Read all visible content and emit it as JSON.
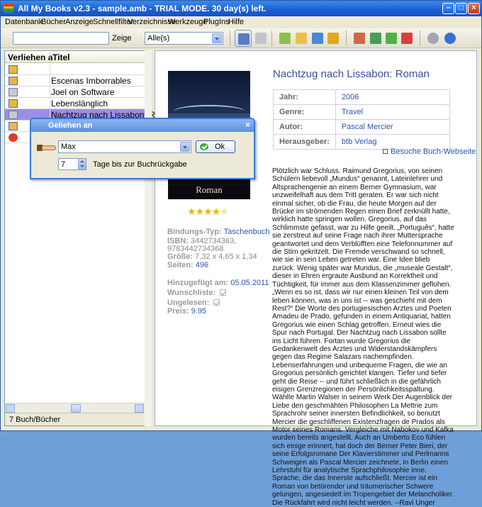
{
  "window": {
    "title": "All My Books v2.3 - sample.amb - TRIAL MODE. 30 day(s) left."
  },
  "menu": [
    "Datenbank",
    "Bücher",
    "Anzeige",
    "Schnellfilter",
    "Verzeichnisse",
    "Werkzeuge",
    "PlugIns",
    "Hilfe"
  ],
  "toolbar": {
    "search_value": "",
    "show_label": "Zeige",
    "filter_value": "Alle(s)",
    "buttons": [
      "view-details-icon",
      "view-books-icon",
      "add-book-icon",
      "open-folder-icon",
      "search-online-icon",
      "key-icon",
      "list-edit-icon",
      "list-add-icon",
      "list-green-icon",
      "list-delete-icon",
      "settings-icon",
      "help-icon"
    ]
  },
  "book_list": {
    "columns": {
      "lent": "Verliehen a",
      "title": "Titel"
    },
    "rows": [
      {
        "status": "book",
        "title": ""
      },
      {
        "status": "book",
        "title": "Escenas Imborrables"
      },
      {
        "status": "cart",
        "title": "Joel on Software"
      },
      {
        "status": "book",
        "title": "Lebenslänglich"
      },
      {
        "status": "cart",
        "title": "Nachtzug nach Lissabon: Ro"
      },
      {
        "status": "book",
        "title": ""
      },
      {
        "status": "warning",
        "title": ""
      }
    ],
    "status_text": "7 Buch/Bücher"
  },
  "book": {
    "title": "Nachtzug nach Lissabon: Roman",
    "cover_text": "Roman",
    "rating": 4,
    "info": [
      {
        "key": "Jahr:",
        "value": "2006"
      },
      {
        "key": "Genre:",
        "value": "Travel"
      },
      {
        "key": "Autor:",
        "value": "Pascal Mercier"
      },
      {
        "key": "Herausgeber:",
        "value": "btb Verlag"
      }
    ],
    "website_label": "Besuche Buch-Webseite",
    "binding_label": "Bindungs-Typ:",
    "binding_value": "Taschenbuch",
    "isbn_label": "ISBN:",
    "isbn_value": "3442734363,",
    "isbn_value2": "9783442734368",
    "size_label": "Größe:",
    "size_value": "7,32 x 4,65 x 1,34",
    "pages_label": "Seiten:",
    "pages_value": "496",
    "added_label": "Hinzugefügt am:",
    "added_value": "05.05.2011",
    "wishlist_label": "Wunschliste:",
    "unread_label": "Ungelesen:",
    "price_label": "Preis:",
    "price_value": "9.95",
    "summary_p1": "Plötzlich war Schluss. Raimund Gregorius, von seinen Schülern liebevoll „Mundus“ genannt, Lateinlehrer und Altsprachengenie an einem Berner Gymnasium, war unzweifelhaft aus dem Tritt geraten. Er war sich nicht einmal sicher, ob die Frau, die heute Morgen auf der Brücke im strömenden Regen einen Brief zerknüllt hatte, wirklich hatte springen wollen. Gregorius, auf das Schlimmste gefasst, war zu Hilfe geeilt. „Português“, hatte sie zerstreut auf seine Frage nach ihrer Muttersprache geantwortet und dem Verblüfften eine Telefonnummer auf die Stirn gekritzelt. Die Fremde verschwand so schnell, wie sie in sein Leben getreten war. Eine Idee blieb zurück. Wenig später war Mundus, die „museale Gestalt“, dieser in Ehren ergraute Ausbund an Korrektheit und Tüchtigkeit, für immer aus dem Klassenzimmer geflohen.",
    "summary_p2": "„Wenn es so ist, dass wir nur einen kleinen Teil von dem leben können, was in uns ist -- was geschieht mit dem Rest?“ Die Worte des portugiesischen Arztes und Poeten Amadeu de Prado, gefunden in einem Antiquariat, hatten Gregorius wie einen Schlag getroffen. Erneut wies die Spur nach Portugal. Der Nachtzug nach Lissabon sollte ins Licht führen. Fortan wurde Gregorius die Gedankenwelt des Arztes und Widerstandskämpfers gegen das Regime Salazars nachempfinden. Lebenserfahrungen und unbequeme Fragen, die wie an Gregorius persönlich gerichtet klangen. Tiefer und tiefer geht die Reise -- und führt schließlich in die gefährlich eisigen Grenzregionen der Persönlichkeitsspaltung.",
    "summary_p3": "Wählte Martin Walser in seinem Werk Der Augenblick der Liebe den geschmähten Philosophen La Mettrie zum Sprachrohr seiner innersten Befindlichkeit, so benutzt Mercier die geschliffenen Existenzfragen de Prados als Motor seines Romans. Vergleiche mit Nabokov und Kafka wurden bereits angestellt. Auch an Umberto Eco fühlen sich einige erinnert, hat doch der Berner Peter Bieri, der seine Erfolgsromane Der Klavierstimmer und Perlmanns Schweigen als Pascal Mercier zeichnete, in Berlin einen Lehrstuhl für analytische Sprachphilosophie inne.",
    "summary_p4": "Sprache, die das Innerste aufschließt. Mercier ist ein Roman von betörender und träumerischer Schwere gelungen, angesiedelt im Tropengebiet der Melancholiker. Die Rückfahrt wird nicht leicht werden. --Ravi Unger"
  },
  "lend_dialog": {
    "title": "Geliehen an",
    "name_value": "Max",
    "ok_label": "Ok",
    "days_value": "7",
    "days_label": "Tage bis zur Buchrückgabe"
  }
}
